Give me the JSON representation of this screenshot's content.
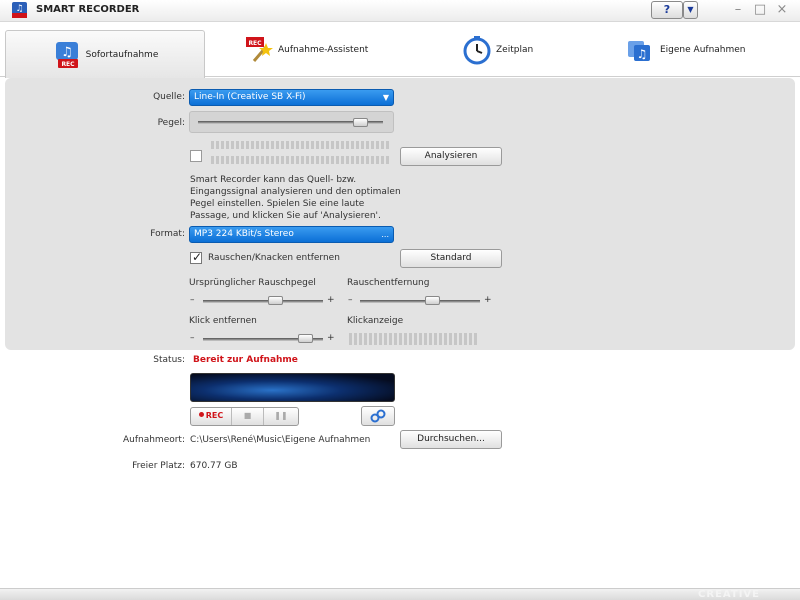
{
  "window": {
    "title": "SMART RECORDER",
    "help_label": "?",
    "help_arrow": "▼",
    "minimize": "–",
    "maximize": "□",
    "close": "×"
  },
  "tabs": [
    {
      "label": "Sofortaufnahme",
      "icon": "instant-record-icon",
      "active": true
    },
    {
      "label": "Aufnahme-Assistent",
      "icon": "wizard-icon",
      "active": false
    },
    {
      "label": "Zeitplan",
      "icon": "clock-icon",
      "active": false
    },
    {
      "label": "Eigene Aufnahmen",
      "icon": "my-recordings-icon",
      "active": false
    }
  ],
  "source": {
    "label": "Quelle:",
    "value": "Line-In (Creative SB X-Fi)"
  },
  "level": {
    "label": "Pegel:",
    "fraction": 0.9
  },
  "analyze": {
    "button": "Analysieren",
    "description": "Smart Recorder kann das Quell- bzw. Eingangssignal analysieren und den optimalen Pegel einstellen. Spielen Sie eine laute Passage, und klicken Sie auf 'Analysieren'."
  },
  "format": {
    "label": "Format:",
    "value": "MP3 224 KBit/s Stereo",
    "more": "..."
  },
  "noise": {
    "checkbox_label": "Rauschen/Knacken entfernen",
    "checked": true,
    "standard_button": "Standard",
    "original_noise_label": "Ursprünglicher Rauschpegel",
    "original_noise_fraction": 0.6,
    "noise_removal_label": "Rauschentfernung",
    "noise_removal_fraction": 0.6,
    "click_removal_label": "Klick entfernen",
    "click_removal_fraction": 0.85,
    "click_display_label": "Klickanzeige",
    "minus": "–",
    "plus": "+"
  },
  "status": {
    "label": "Status:",
    "value": "Bereit zur Aufnahme",
    "value_color": "#d0141a"
  },
  "controls": {
    "rec_label": "REC"
  },
  "destination": {
    "label": "Aufnahmeort:",
    "value": "C:\\Users\\René\\Music\\Eigene Aufnahmen",
    "browse_button": "Durchsuchen..."
  },
  "free_space": {
    "label": "Freier Platz:",
    "value": "670.77 GB"
  },
  "footer": {
    "brand": "CREATIVE"
  },
  "colors": {
    "accent": "#0b6fd6",
    "status": "#d0141a",
    "panel": "#e3e3e3"
  }
}
